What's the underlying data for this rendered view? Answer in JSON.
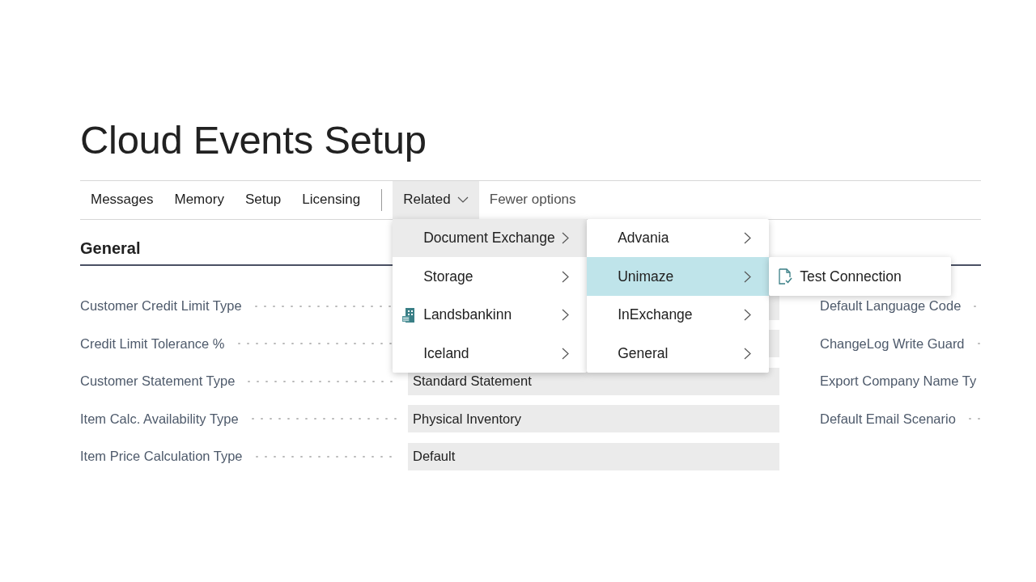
{
  "page": {
    "title": "Cloud Events Setup"
  },
  "action_bar": {
    "items": [
      {
        "label": "Messages",
        "kind": "action",
        "selected": false
      },
      {
        "label": "Memory",
        "kind": "action",
        "selected": false
      },
      {
        "label": "Setup",
        "kind": "action",
        "selected": false
      },
      {
        "label": "Licensing",
        "kind": "action",
        "selected": false
      },
      {
        "kind": "separator"
      },
      {
        "label": "Related",
        "kind": "dropdown",
        "selected": true
      },
      {
        "label": "Fewer options",
        "kind": "secondary",
        "selected": false
      }
    ]
  },
  "section": {
    "title": "General"
  },
  "left_fields": [
    {
      "label": "Customer Credit Limit Type"
    },
    {
      "label": "Credit Limit Tolerance %"
    },
    {
      "label": "Customer Statement Type",
      "value": "Standard Statement"
    },
    {
      "label": "Item Calc. Availability Type",
      "value": "Physical Inventory"
    },
    {
      "label": "Item Price Calculation Type",
      "value": "Default"
    }
  ],
  "right_fields": [
    {
      "label": "Default Language Code"
    },
    {
      "label": "ChangeLog Write Guard"
    },
    {
      "label": "Export Company Name Ty"
    },
    {
      "label": "Default Email Scenario"
    }
  ],
  "menus": [
    {
      "items": [
        {
          "label": "Document Exchange",
          "selected": true,
          "has_submenu": true,
          "has_icon": false
        },
        {
          "label": "Storage",
          "selected": false,
          "has_submenu": true,
          "has_icon": false
        },
        {
          "label": "Landsbankinn",
          "selected": false,
          "has_submenu": true,
          "has_icon": true
        },
        {
          "label": "Iceland",
          "selected": false,
          "has_submenu": true,
          "has_icon": false
        }
      ]
    },
    {
      "items": [
        {
          "label": "Advania",
          "selected": false,
          "has_submenu": true,
          "has_icon": false
        },
        {
          "label": "Unimaze",
          "selected": true,
          "has_submenu": true,
          "has_icon": false
        },
        {
          "label": "InExchange",
          "selected": false,
          "has_submenu": true,
          "has_icon": false
        },
        {
          "label": "General",
          "selected": false,
          "has_submenu": true,
          "has_icon": false
        }
      ]
    },
    {
      "items": [
        {
          "label": "Test Connection",
          "selected": false,
          "has_submenu": false,
          "has_icon": true
        }
      ]
    }
  ]
}
